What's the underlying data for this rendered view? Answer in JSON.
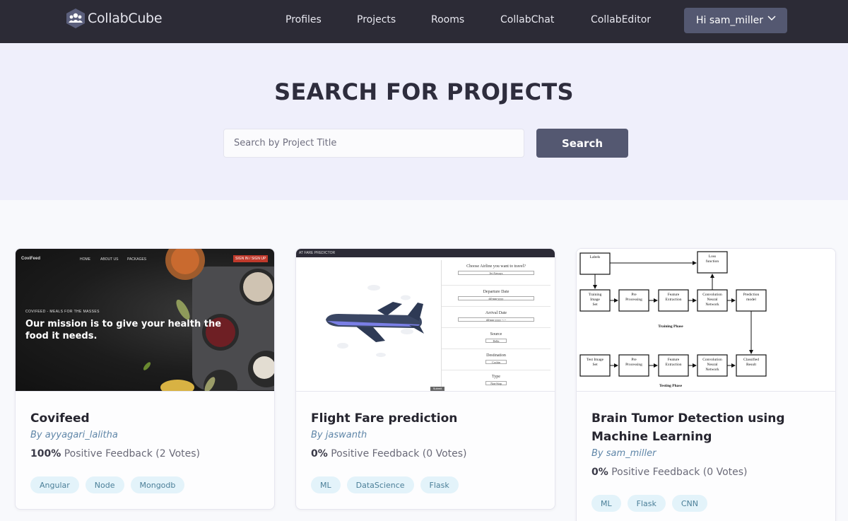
{
  "nav": {
    "brand": "CollabCube",
    "links": [
      "Profiles",
      "Projects",
      "Rooms",
      "CollabChat",
      "CollabEditor"
    ],
    "user_greeting": "Hi sam_miller"
  },
  "hero": {
    "title_light": "SEARCH FOR ",
    "title_bold": "PROJECTS",
    "search_placeholder": "Search by Project Title",
    "search_button": "Search"
  },
  "projects": [
    {
      "title": "Covifeed",
      "author": "By ayyagari_lalitha",
      "feedback_pct": "100%",
      "feedback_text": " Positive Feedback (2 Votes)",
      "tags": [
        "Angular",
        "Node",
        "Mongodb"
      ],
      "thumbnail": {
        "nav_logo": "CoviFeed",
        "nav_items": [
          "HOME",
          "ABOUT US",
          "PACKAGES"
        ],
        "nav_cta": "SIGN IN / SIGN UP",
        "tagline": "COVIFEED - MEALS FOR THE MASSES",
        "headline": "Our mission is to give your health the food it needs."
      }
    },
    {
      "title": "Flight Fare prediction",
      "author": "By jaswanth",
      "feedback_pct": "0%",
      "feedback_text": " Positive Feedback (0 Votes)",
      "tags": [
        "ML",
        "DataScience",
        "Flask"
      ],
      "thumbnail": {
        "bar": "AT FARE PREDICTOR",
        "fields": [
          {
            "label": "Choose Airline you want to travel?",
            "value": "Jet Airways"
          },
          {
            "label": "Departure Date",
            "value": "dd-mm-yyyy"
          },
          {
            "label": "Arrival Date",
            "value": "dd-mm-yyyy --:--"
          },
          {
            "label": "Source",
            "value": "Delhi"
          },
          {
            "label": "Destination",
            "value": "Cochin"
          },
          {
            "label": "Type",
            "value": "Non-Stop"
          }
        ],
        "submit": "Submit"
      }
    },
    {
      "title": "Brain Tumor Detection using Machine Learning",
      "author": "By sam_miller",
      "feedback_pct": "0%",
      "feedback_text": " Positive Feedback (0 Votes)",
      "tags": [
        "ML",
        "Flask",
        "CNN"
      ],
      "thumbnail": {
        "top_boxes": [
          "Labels",
          "Loss function"
        ],
        "train_boxes": [
          "Training Image Set",
          "Pre Processing",
          "Feature Extraction",
          "Convolution Neural Network",
          "Prediction model"
        ],
        "test_boxes": [
          "Test Image Set",
          "Pre Processing",
          "Feature Extraction",
          "Convolution Neural Network",
          "Classified Result"
        ],
        "train_label": "Training Phase",
        "test_label": "Testing Phase"
      }
    }
  ]
}
